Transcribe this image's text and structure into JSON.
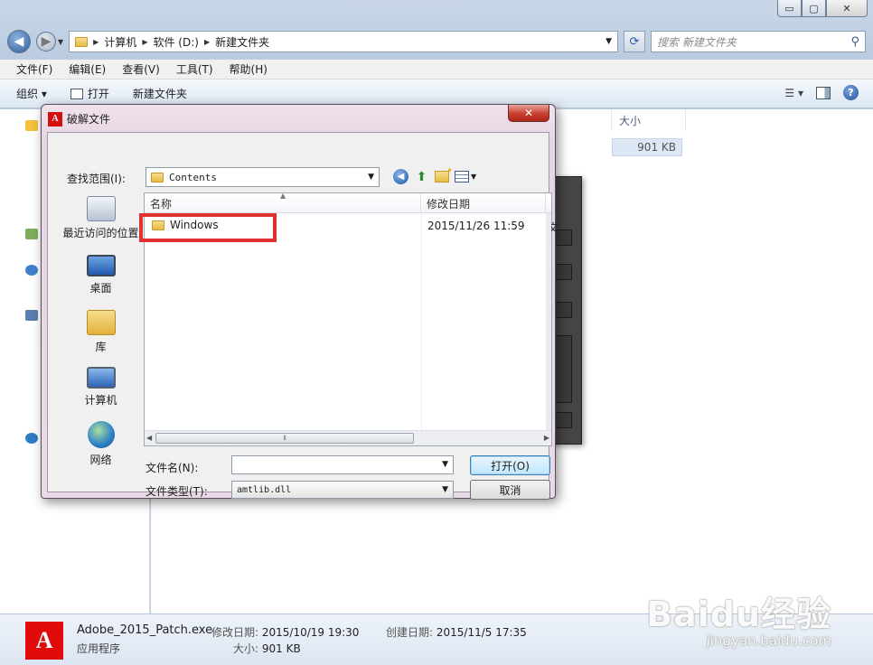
{
  "explorer": {
    "caption_buttons": {
      "minimize": "▭",
      "maximize": "▢",
      "close": "✕"
    },
    "breadcrumbs": [
      "计算机",
      "软件 (D:)",
      "新建文件夹"
    ],
    "search_placeholder": "搜索 新建文件夹",
    "menu": [
      "文件(F)",
      "编辑(E)",
      "查看(V)",
      "工具(T)",
      "帮助(H)"
    ],
    "toolbar": {
      "organize": "组织 ▾",
      "open": "打开",
      "new_folder": "新建文件夹"
    },
    "columns": {
      "name": "名称",
      "modified": "修改日期",
      "size": "大小"
    },
    "file_size": "901 KB",
    "details": {
      "file_name": "Adobe_2015_Patch.exe",
      "file_type": "应用程序",
      "modified_label": "修改日期:",
      "modified_value": "2015/10/19 19:30",
      "created_label": "创建日期:",
      "created_value": "2015/11/5 17:35",
      "size_label": "大小:",
      "size_value": "901 KB",
      "icon_letter": "A"
    }
  },
  "dialog": {
    "title": "破解文件",
    "icon_letter": "A",
    "close_glyph": "✕",
    "lookin_label": "查找范围(I):",
    "lookin_value": "Contents",
    "places": {
      "recent": "最近访问的位置",
      "desktop": "桌面",
      "library": "库",
      "computer": "计算机",
      "network": "网络"
    },
    "columns": {
      "name": "名称",
      "modified": "修改日期"
    },
    "rows": [
      {
        "name": "Windows",
        "modified": "2015/11/26 11:59",
        "trunc": "文"
      }
    ],
    "filename_label": "文件名(N):",
    "filename_value": "",
    "filetype_label": "文件类型(T):",
    "filetype_value": "amtlib.dll",
    "open_button": "打开(O)",
    "cancel_button": "取消"
  },
  "watermark": {
    "main": "Baidu经验",
    "sub": "jingyan.baidu.com"
  },
  "colors": {
    "highlight": "#e03030",
    "adobe_red": "#e10b0b",
    "accent": "#3c7fb1"
  }
}
